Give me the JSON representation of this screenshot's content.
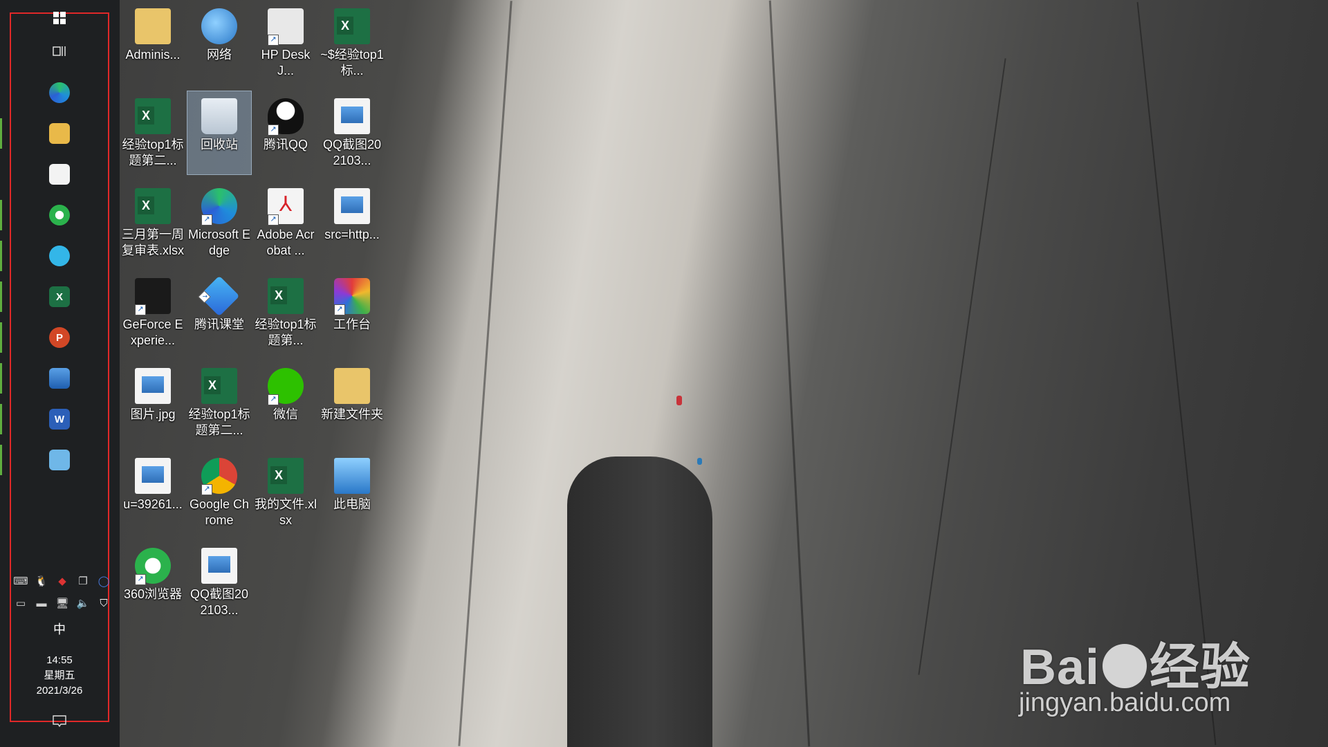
{
  "desktop": {
    "icons": [
      {
        "label": "Adminis...",
        "icon": "user-folder-icon"
      },
      {
        "label": "网络",
        "icon": "network-icon"
      },
      {
        "label": "HP DeskJ...",
        "icon": "printer-icon"
      },
      {
        "label": "~$经验top1标...",
        "icon": "excel-file-icon"
      },
      {
        "label": "经验top1标题第二...",
        "icon": "excel-file-icon"
      },
      {
        "label": "回收站",
        "icon": "recycle-bin-icon"
      },
      {
        "label": "腾讯QQ",
        "icon": "qq-icon"
      },
      {
        "label": "QQ截图202103...",
        "icon": "image-file-icon"
      },
      {
        "label": "三月第一周复审表.xlsx",
        "icon": "excel-file-icon"
      },
      {
        "label": "Microsoft Edge",
        "icon": "edge-icon"
      },
      {
        "label": "Adobe Acrobat ...",
        "icon": "acrobat-icon"
      },
      {
        "label": "src=http...",
        "icon": "image-file-icon"
      },
      {
        "label": "GeForce Experie...",
        "icon": "geforce-icon"
      },
      {
        "label": "腾讯课堂",
        "icon": "tencent-classroom-icon"
      },
      {
        "label": "经验top1标题第...",
        "icon": "excel-file-icon"
      },
      {
        "label": "工作台",
        "icon": "workbench-icon"
      },
      {
        "label": "图片.jpg",
        "icon": "image-file-icon"
      },
      {
        "label": "经验top1标题第二...",
        "icon": "excel-file-icon"
      },
      {
        "label": "微信",
        "icon": "wechat-icon"
      },
      {
        "label": "新建文件夹",
        "icon": "folder-icon"
      },
      {
        "label": "u=39261...",
        "icon": "image-file-icon"
      },
      {
        "label": "Google Chrome",
        "icon": "chrome-icon"
      },
      {
        "label": "我的文件.xlsx",
        "icon": "excel-file-icon"
      },
      {
        "label": "此电脑",
        "icon": "this-pc-icon"
      },
      {
        "label": "360浏览器",
        "icon": "browser-360-icon"
      },
      {
        "label": "QQ截图202103...",
        "icon": "image-file-icon"
      }
    ],
    "selected_label": "回收站"
  },
  "taskbar": {
    "start_icon": "windows-start-icon",
    "task_view_icon": "task-view-icon",
    "pinned": [
      {
        "name": "edge",
        "icon": "edge-icon",
        "running": false
      },
      {
        "name": "file-explorer",
        "icon": "folder-icon",
        "running": true
      },
      {
        "name": "store",
        "icon": "store-icon",
        "running": false
      },
      {
        "name": "browser-360",
        "icon": "browser-360-icon",
        "running": true
      },
      {
        "name": "app-blue",
        "icon": "pen-app-icon",
        "running": true
      },
      {
        "name": "excel",
        "icon": "excel-icon",
        "running": true
      },
      {
        "name": "powerpoint",
        "icon": "powerpoint-icon",
        "running": true
      },
      {
        "name": "photos",
        "icon": "photos-icon",
        "running": true
      },
      {
        "name": "word",
        "icon": "word-icon",
        "running": true
      },
      {
        "name": "control-app",
        "icon": "id-card-icon",
        "running": true
      }
    ],
    "ime": "中",
    "time": "14:55",
    "weekday": "星期五",
    "date": "2021/3/26"
  },
  "watermark": {
    "logo_text_1": "Bai",
    "logo_text_2": "经验",
    "url": "jingyan.baidu.com"
  },
  "colors": {
    "highlight_border": "#e02828",
    "taskbar_bg": "#1e2022",
    "running_indicator": "#5fae3f"
  }
}
